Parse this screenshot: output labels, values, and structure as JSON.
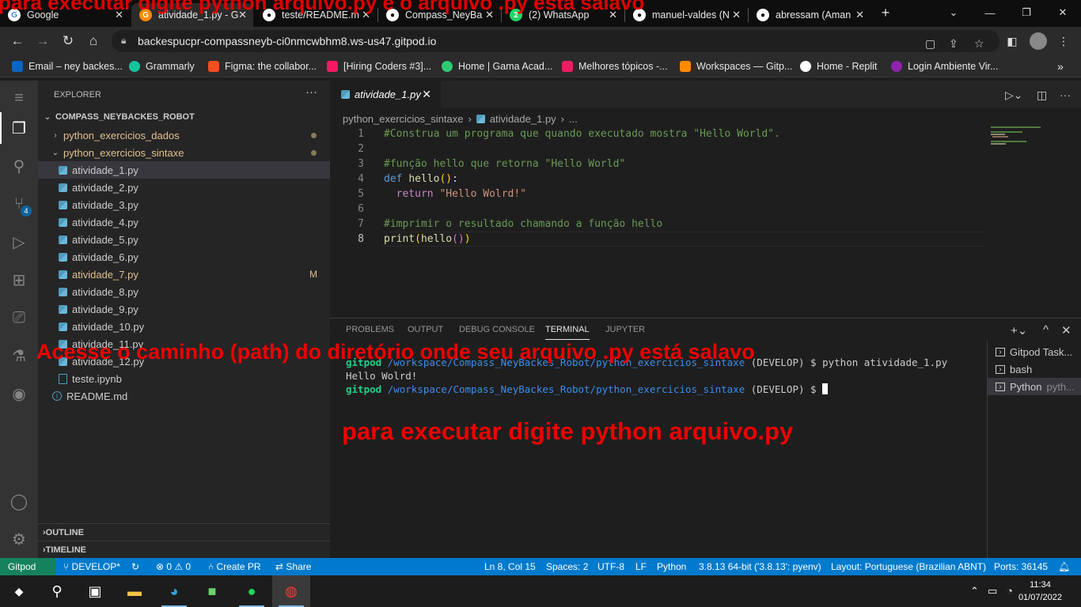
{
  "browser": {
    "tabs": [
      {
        "label": "Google",
        "icon": "google-icon",
        "color": "#4285f4"
      },
      {
        "label": "atividade_1.py - G",
        "icon": "gitpod-icon",
        "color": "#ff8a00"
      },
      {
        "label": "teste/README.m",
        "icon": "github-icon",
        "color": "#ffffff"
      },
      {
        "label": "Compass_NeyBa",
        "icon": "github-icon",
        "color": "#ffffff"
      },
      {
        "label": "(2) WhatsApp",
        "icon": "whatsapp-icon",
        "color": "#25d366"
      },
      {
        "label": "manuel-valdes (N",
        "icon": "github-icon",
        "color": "#ffffff"
      },
      {
        "label": "abressam (Aman",
        "icon": "github-icon",
        "color": "#ffffff"
      }
    ],
    "new_tab": "+",
    "url": "backespucpr-compassneyb-ci0nmcwbhm8.ws-us47.gitpod.io",
    "bookmarks": [
      {
        "label": "Email – ney backes...",
        "color": "#0a66c2"
      },
      {
        "label": "Grammarly",
        "color": "#15c39a"
      },
      {
        "label": "Figma: the collabor...",
        "color": "#f24e1e"
      },
      {
        "label": "[Hiring Coders #3]...",
        "color": "#f71963"
      },
      {
        "label": "Home | Gama Acad...",
        "color": "#2ecc71"
      },
      {
        "label": "Melhores tópicos -...",
        "color": "#e91e63"
      },
      {
        "label": "Workspaces — Gitp...",
        "color": "#ff8a00"
      },
      {
        "label": "Home - Replit",
        "color": "#ffffff"
      },
      {
        "label": "Login Ambiente Vir...",
        "color": "#8e24aa"
      }
    ]
  },
  "explorer": {
    "title": "EXPLORER",
    "root": "COMPASS_NEYBACKES_ROBOT",
    "folders": [
      "python_exercicios_dados",
      "python_exercicios_sintaxe"
    ],
    "files": [
      "atividade_1.py",
      "atividade_2.py",
      "atividade_3.py",
      "atividade_4.py",
      "atividade_5.py",
      "atividade_6.py",
      "atividade_7.py",
      "atividade_8.py",
      "atividade_9.py",
      "atividade_10.py",
      "atividade_11.py",
      "atividade_12.py",
      "teste.ipynb"
    ],
    "modified_marker": "M",
    "readme": "README.md",
    "outline": "OUTLINE",
    "timeline": "TIMELINE",
    "scm_badge": "4"
  },
  "editor": {
    "tab": "atividade_1.py",
    "breadcrumb": [
      "python_exercicios_sintaxe",
      "atividade_1.py",
      "..."
    ],
    "line_numbers": [
      "1",
      "2",
      "3",
      "4",
      "5",
      "6",
      "7",
      "8"
    ],
    "code": {
      "l1": "#Construa um programa que quando executado mostra \"Hello World\".",
      "l3": "#função hello que retorna \"Hello World\"",
      "l4_kw": "def",
      "l4_fn": "hello",
      "l5_kw": "return",
      "l5_str": "\"Hello Wolrd!\"",
      "l7": "#imprimir o resultado chamando a função hello",
      "l8_fn": "print",
      "l8_arg": "hello"
    }
  },
  "panel": {
    "tabs": [
      "PROBLEMS",
      "OUTPUT",
      "DEBUG CONSOLE",
      "TERMINAL",
      "JUPYTER"
    ],
    "prompt_user": "gitpod",
    "prompt_path": "/workspace/Compass_NeyBackes_Robot/python_exercicios_sintaxe",
    "branch": "(DEVELOP) $",
    "command": "python atividade_1.py",
    "output": "Hello Wolrd!",
    "terminals": [
      {
        "label": "Gitpod Task..."
      },
      {
        "label": "bash"
      },
      {
        "label": "Python",
        "sub": "pyth..."
      }
    ]
  },
  "statusbar": {
    "gitpod": "Gitpod",
    "branch": "DEVELOP*",
    "problems": "0",
    "warnings": "0",
    "create_pr": "Create PR",
    "share": "Share",
    "position": "Ln 8, Col 15",
    "spaces": "Spaces: 2",
    "encoding": "UTF-8",
    "eol": "LF",
    "language": "Python",
    "interpreter": "3.8.13 64-bit ('3.8.13': pyenv)",
    "layout": "Layout: Portuguese (Brazilian ABNT)",
    "ports": "Ports: 36145"
  },
  "taskbar": {
    "time": "11:34",
    "date": "01/07/2022"
  },
  "annotations": {
    "top": "para executar digite python arquivo.py e o arquivo .py esta salavo",
    "path": "Acesse o caminho (path) do diretório onde seu arquivo .py está salavo",
    "run": "para executar digite python arquivo.py"
  }
}
